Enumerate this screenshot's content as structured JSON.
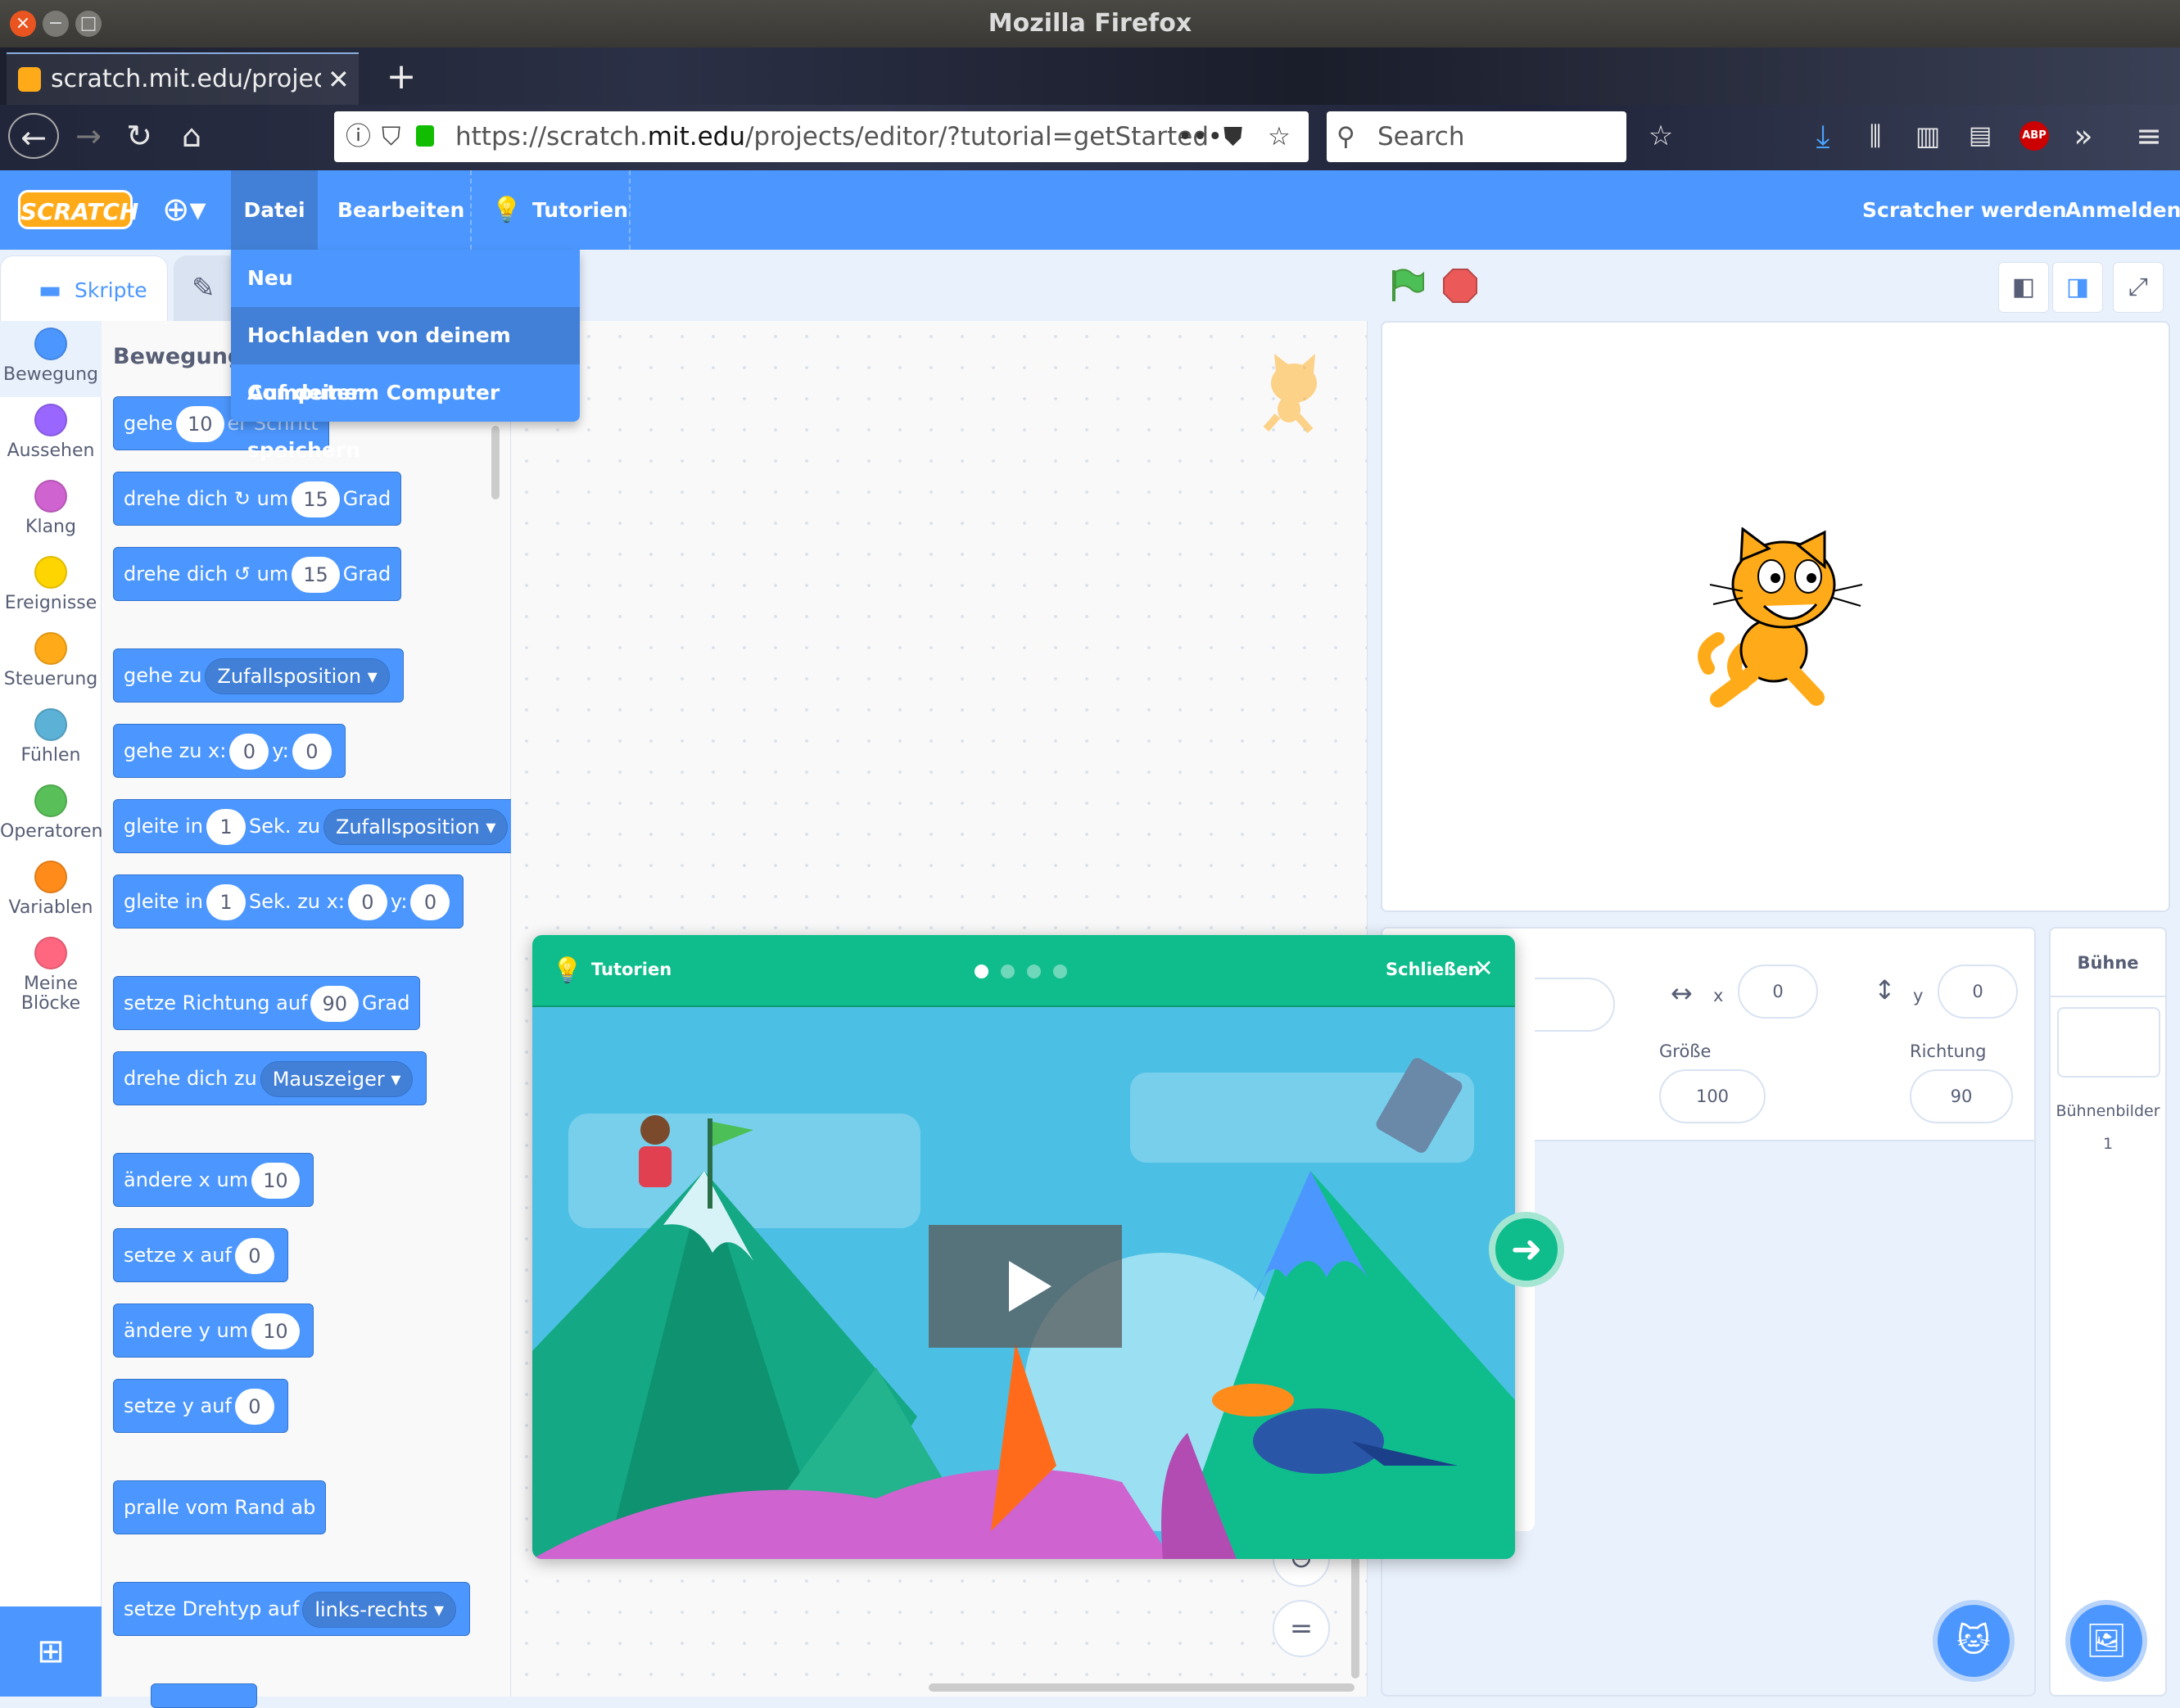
{
  "browser": {
    "window_title": "Mozilla Firefox",
    "tab_title": "scratch.mit.edu/projects",
    "url_prefix": "https://scratch.",
    "url_domain": "mit.edu",
    "url_path": "/projects/editor/?tutorial=getStarted",
    "search_placeholder": "Search",
    "adblock_label": "ABP"
  },
  "menubar": {
    "logo": "SCRATCH",
    "file": "Datei",
    "edit": "Bearbeiten",
    "tutorials": "Tutorien",
    "join": "Scratcher werden",
    "signin": "Anmelden"
  },
  "file_menu": {
    "items": [
      "Neu",
      "Hochladen von deinem Computer",
      "Auf deinem Computer speichern"
    ]
  },
  "tabs": {
    "scripts": "Skripte"
  },
  "categories": [
    {
      "label": "Bewegung",
      "color": "#4c97ff"
    },
    {
      "label": "Aussehen",
      "color": "#9966ff"
    },
    {
      "label": "Klang",
      "color": "#cf63cf"
    },
    {
      "label": "Ereignisse",
      "color": "#ffd500"
    },
    {
      "label": "Steuerung",
      "color": "#ffab19"
    },
    {
      "label": "Fühlen",
      "color": "#5cb1d6"
    },
    {
      "label": "Operatoren",
      "color": "#59c059"
    },
    {
      "label": "Variablen",
      "color": "#ff8c1a"
    },
    {
      "label": "Meine\nBlöcke",
      "color": "#ff6680"
    }
  ],
  "palette": {
    "heading": "Bewegung",
    "b1": {
      "a": "gehe",
      "v": "10",
      "b": "er Schritt"
    },
    "b2": {
      "a": "drehe dich",
      "b": "um",
      "v": "15",
      "c": "Grad"
    },
    "b3": {
      "a": "drehe dich",
      "b": "um",
      "v": "15",
      "c": "Grad"
    },
    "b4": {
      "a": "gehe zu",
      "d": "Zufallsposition"
    },
    "b5": {
      "a": "gehe zu x:",
      "x": "0",
      "b": "y:",
      "y": "0"
    },
    "b6": {
      "a": "gleite in",
      "v": "1",
      "b": "Sek. zu",
      "d": "Zufallsposition"
    },
    "b7": {
      "a": "gleite in",
      "v": "1",
      "b": "Sek. zu x:",
      "x": "0",
      "c": "y:",
      "y": "0"
    },
    "b8": {
      "a": "setze Richtung auf",
      "v": "90",
      "b": "Grad"
    },
    "b9": {
      "a": "drehe dich zu",
      "d": "Mauszeiger"
    },
    "b10": {
      "a": "ändere x um",
      "v": "10"
    },
    "b11": {
      "a": "setze x auf",
      "v": "0"
    },
    "b12": {
      "a": "ändere y um",
      "v": "10"
    },
    "b13": {
      "a": "setze y auf",
      "v": "0"
    },
    "b14": {
      "a": "pralle vom Rand ab"
    },
    "b15": {
      "a": "setze Drehtyp auf",
      "d": "links-rechts"
    }
  },
  "workspace": {
    "zoom_reset": "="
  },
  "sprite_info": {
    "x_label": "x",
    "x_value": "0",
    "y_label": "y",
    "y_value": "0",
    "size_label": "Größe",
    "size_value": "100",
    "direction_label": "Richtung",
    "direction_value": "90"
  },
  "stage_panel": {
    "title": "Bühne",
    "backdrops_label": "Bühnenbilder",
    "backdrops_count": "1"
  },
  "tutorial": {
    "title": "Tutorien",
    "close": "Schließen",
    "steps": 4,
    "current_step": 1
  },
  "colors": {
    "scratch_blue": "#4c97ff",
    "tutorial_green": "#0fbd8c"
  }
}
